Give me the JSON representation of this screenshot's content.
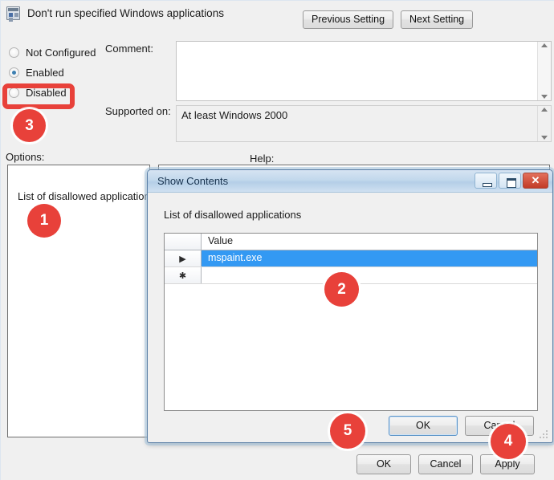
{
  "window": {
    "title": "Don't run specified Windows applications",
    "icon": "policy-setting-icon"
  },
  "nav": {
    "previous_label": "Previous Setting",
    "next_label": "Next Setting"
  },
  "state_radios": [
    {
      "label": "Not Configured",
      "selected": false
    },
    {
      "label": "Enabled",
      "selected": true
    },
    {
      "label": "Disabled",
      "selected": false
    }
  ],
  "fields": {
    "comment_label": "Comment:",
    "comment_value": "",
    "supported_label": "Supported on:",
    "supported_value": "At least Windows 2000"
  },
  "panes": {
    "options_label": "Options:",
    "options_content": "List of disallowed applications",
    "help_label": "Help:",
    "help_content": ""
  },
  "main_buttons": {
    "ok": "OK",
    "cancel": "Cancel",
    "apply": "Apply"
  },
  "dialog": {
    "title": "Show Contents",
    "subtitle": "List of disallowed applications",
    "caption": {
      "minimize": "minimize-icon",
      "maximize": "maximize-icon",
      "close": "close-icon",
      "close_glyph": "✕"
    },
    "grid": {
      "columns": [
        "",
        "Value"
      ],
      "rows": [
        {
          "indicator": "▶",
          "value": "mspaint.exe",
          "selected": true
        },
        {
          "indicator": "✱",
          "value": "",
          "selected": false
        }
      ]
    },
    "buttons": {
      "ok": "OK",
      "cancel": "Cancel"
    }
  },
  "annotations": {
    "badges": [
      {
        "number": "1"
      },
      {
        "number": "2"
      },
      {
        "number": "3"
      },
      {
        "number": "4"
      },
      {
        "number": "5"
      }
    ],
    "accent_color": "#e8413a"
  }
}
